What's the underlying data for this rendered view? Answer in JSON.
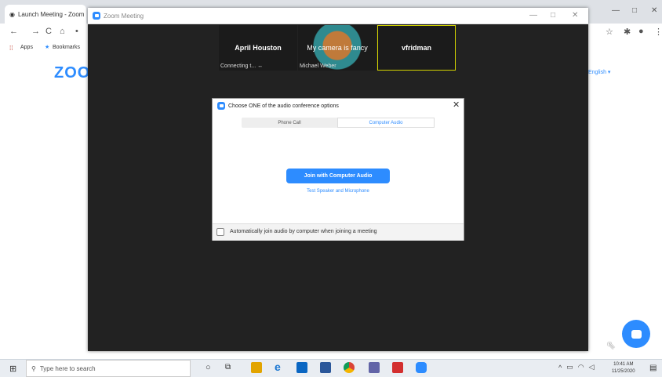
{
  "browser": {
    "tab_title": "Launch Meeting - Zoom",
    "bookmarks": [
      "Apps",
      "Bookmarks"
    ],
    "page_logo": "ZOO",
    "language": "English ▾"
  },
  "zoom_window": {
    "title": "Zoom Meeting",
    "participants": [
      {
        "name": "April Houston",
        "caption": "Connecting t... ↔"
      },
      {
        "name": "My camera is fancy",
        "caption": "Michael Weber"
      },
      {
        "name": "vfridman",
        "caption": ""
      }
    ]
  },
  "audio_dialog": {
    "title": "Choose ONE of the audio conference options",
    "tabs": [
      "Phone Call",
      "Computer Audio"
    ],
    "active_tab": "Computer Audio",
    "join_button": "Join with Computer Audio",
    "test_link": "Test Speaker and Microphone",
    "auto_join_label": "Automatically join audio by computer when joining a meeting",
    "auto_join_checked": false
  },
  "taskbar": {
    "search_placeholder": "Type here to search",
    "time": "10:41 AM",
    "date": "11/25/2020"
  },
  "colors": {
    "accent": "#2d8cff",
    "meeting_bg": "#222222"
  }
}
